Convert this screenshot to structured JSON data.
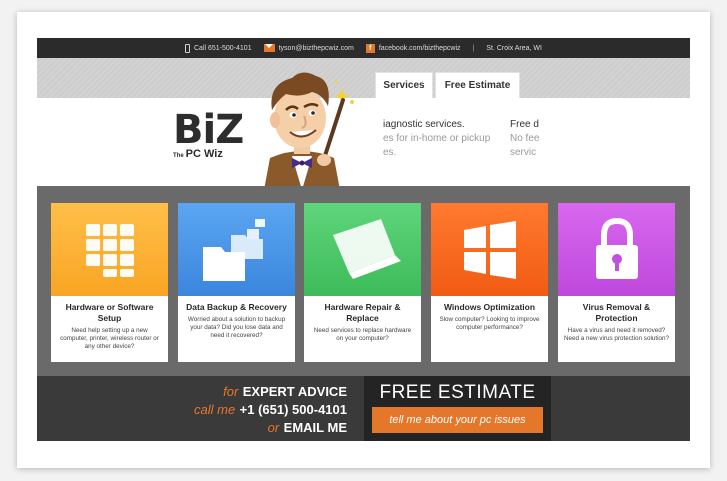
{
  "topbar": {
    "phone": "Call 651-500-4101",
    "email": "tyson@bizthepcwiz.com",
    "facebook": "facebook.com/bizthepcwiz",
    "separator": "|",
    "location": "St. Croix Area, WI",
    "fb_glyph": "f"
  },
  "nav": {
    "tab_services": "Services",
    "tab_estimate": "Free Estimate"
  },
  "logo": {
    "main": "BiZ",
    "the": "The",
    "sub": "PC Wiz"
  },
  "blurb_left": {
    "line1": "iagnostic services.",
    "line2": "es for in-home or pickup",
    "line3": "es."
  },
  "blurb_right": {
    "line1": "Free d",
    "line2": "No fee",
    "line3": "servic"
  },
  "services": [
    {
      "title": "Hardware or Software Setup",
      "desc": "Need help setting up a new computer, printer, wireless router or any other device?",
      "icon": "grid-tiles-icon"
    },
    {
      "title": "Data Backup & Recovery",
      "desc": "Worried about a solution to backup your data? Did you lose data and need it recovered?",
      "icon": "folders-icon"
    },
    {
      "title": "Hardware Repair & Replace",
      "desc": "Need services to replace hardware on your computer?",
      "icon": "laptop-icon"
    },
    {
      "title": "Windows Optimization",
      "desc": "Slow computer? Looking to improve computer performance?",
      "icon": "windows-logo-icon"
    },
    {
      "title": "Virus Removal & Protection",
      "desc": "Have a virus and need it removed? Need a new virus protection solution?",
      "icon": "padlock-icon"
    }
  ],
  "footer": {
    "for": "for",
    "expert": "EXPERT ADVICE",
    "call_me": "call me",
    "phone": "+1 (651) 500-4101",
    "or": "or",
    "email_me": "EMAIL ME",
    "estimate_title": "FREE ESTIMATE",
    "estimate_button": "tell me about your pc issues"
  },
  "colors": {
    "accent": "#e5772a",
    "topbar": "#2b2b2b",
    "services_bg": "#6a6a6a",
    "footer": "#3a3a3a"
  }
}
